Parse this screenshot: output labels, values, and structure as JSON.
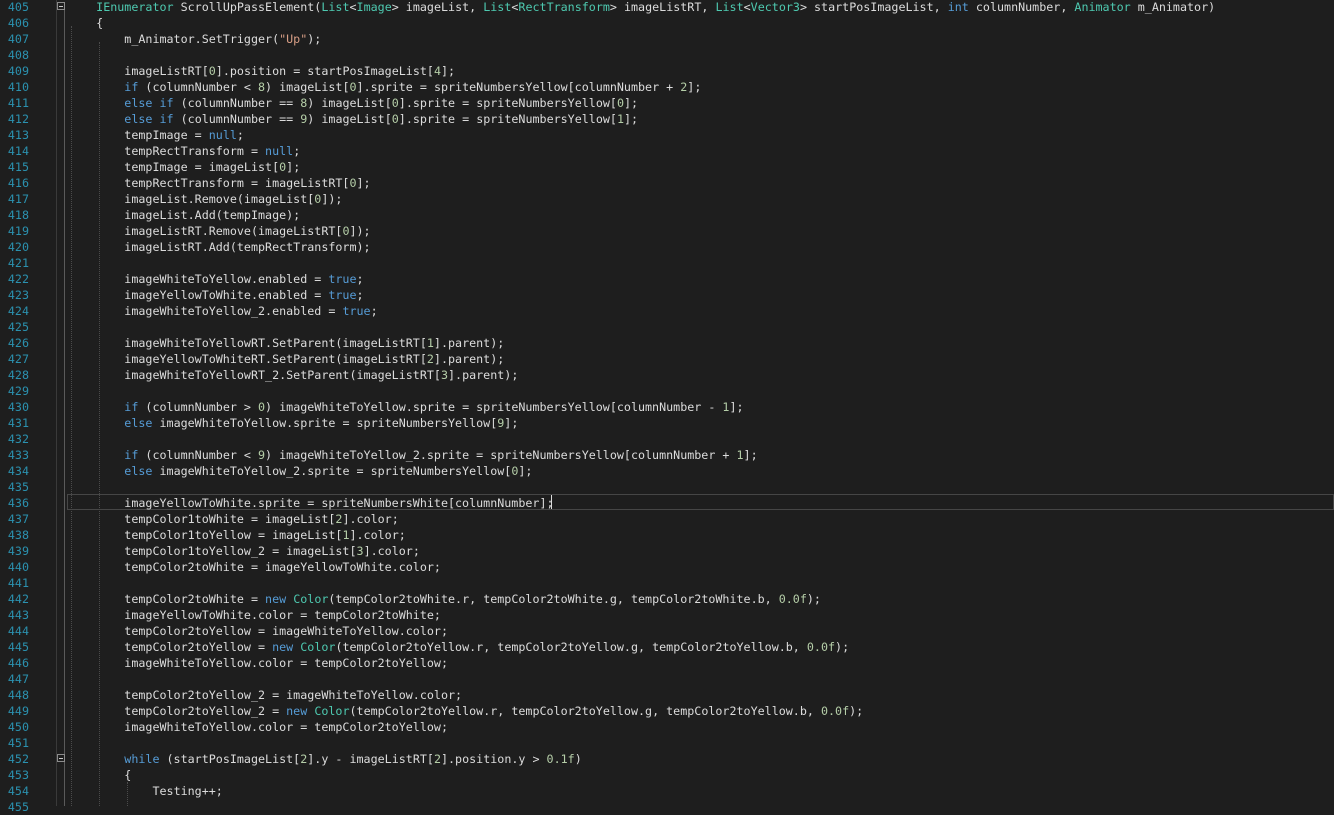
{
  "editor": {
    "language": "C#",
    "colors": {
      "background": "#1e1e1e",
      "line_number": "#2b91af",
      "keyword": "#569cd6",
      "type": "#4ec9b0",
      "string": "#d69d85",
      "number": "#b5cea8",
      "plain": "#dcdcdc"
    },
    "current_line": "436",
    "lines": [
      {
        "num": "405",
        "indent": "    ",
        "fold": true,
        "tokens": [
          {
            "t": "ty",
            "v": "IEnumerator"
          },
          {
            "t": "pl",
            "v": " ScrollUpPassElement("
          },
          {
            "t": "ty",
            "v": "List"
          },
          {
            "t": "pl",
            "v": "<"
          },
          {
            "t": "ty",
            "v": "Image"
          },
          {
            "t": "pl",
            "v": "> imageList, "
          },
          {
            "t": "ty",
            "v": "List"
          },
          {
            "t": "pl",
            "v": "<"
          },
          {
            "t": "ty",
            "v": "RectTransform"
          },
          {
            "t": "pl",
            "v": "> imageListRT, "
          },
          {
            "t": "ty",
            "v": "List"
          },
          {
            "t": "pl",
            "v": "<"
          },
          {
            "t": "ty",
            "v": "Vector3"
          },
          {
            "t": "pl",
            "v": "> startPosImageList, "
          },
          {
            "t": "kw",
            "v": "int"
          },
          {
            "t": "pl",
            "v": " columnNumber, "
          },
          {
            "t": "ty",
            "v": "Animator"
          },
          {
            "t": "pl",
            "v": " m_Animator)"
          }
        ]
      },
      {
        "num": "406",
        "indent": "    ",
        "tokens": [
          {
            "t": "pl",
            "v": "{"
          }
        ]
      },
      {
        "num": "407",
        "indent": "        ",
        "tokens": [
          {
            "t": "pl",
            "v": "m_Animator.SetTrigger("
          },
          {
            "t": "str",
            "v": "\"Up\""
          },
          {
            "t": "pl",
            "v": ");"
          }
        ]
      },
      {
        "num": "408",
        "indent": "",
        "tokens": []
      },
      {
        "num": "409",
        "indent": "        ",
        "tokens": [
          {
            "t": "pl",
            "v": "imageListRT["
          },
          {
            "t": "num",
            "v": "0"
          },
          {
            "t": "pl",
            "v": "].position = startPosImageList["
          },
          {
            "t": "num",
            "v": "4"
          },
          {
            "t": "pl",
            "v": "];"
          }
        ]
      },
      {
        "num": "410",
        "indent": "        ",
        "tokens": [
          {
            "t": "kw",
            "v": "if"
          },
          {
            "t": "pl",
            "v": " (columnNumber < "
          },
          {
            "t": "num",
            "v": "8"
          },
          {
            "t": "pl",
            "v": ") imageList["
          },
          {
            "t": "num",
            "v": "0"
          },
          {
            "t": "pl",
            "v": "].sprite = spriteNumbersYellow[columnNumber + "
          },
          {
            "t": "num",
            "v": "2"
          },
          {
            "t": "pl",
            "v": "];"
          }
        ]
      },
      {
        "num": "411",
        "indent": "        ",
        "tokens": [
          {
            "t": "kw",
            "v": "else"
          },
          {
            "t": "pl",
            "v": " "
          },
          {
            "t": "kw",
            "v": "if"
          },
          {
            "t": "pl",
            "v": " (columnNumber == "
          },
          {
            "t": "num",
            "v": "8"
          },
          {
            "t": "pl",
            "v": ") imageList["
          },
          {
            "t": "num",
            "v": "0"
          },
          {
            "t": "pl",
            "v": "].sprite = spriteNumbersYellow["
          },
          {
            "t": "num",
            "v": "0"
          },
          {
            "t": "pl",
            "v": "];"
          }
        ]
      },
      {
        "num": "412",
        "indent": "        ",
        "tokens": [
          {
            "t": "kw",
            "v": "else"
          },
          {
            "t": "pl",
            "v": " "
          },
          {
            "t": "kw",
            "v": "if"
          },
          {
            "t": "pl",
            "v": " (columnNumber == "
          },
          {
            "t": "num",
            "v": "9"
          },
          {
            "t": "pl",
            "v": ") imageList["
          },
          {
            "t": "num",
            "v": "0"
          },
          {
            "t": "pl",
            "v": "].sprite = spriteNumbersYellow["
          },
          {
            "t": "num",
            "v": "1"
          },
          {
            "t": "pl",
            "v": "];"
          }
        ]
      },
      {
        "num": "413",
        "indent": "        ",
        "tokens": [
          {
            "t": "pl",
            "v": "tempImage = "
          },
          {
            "t": "kw",
            "v": "null"
          },
          {
            "t": "pl",
            "v": ";"
          }
        ]
      },
      {
        "num": "414",
        "indent": "        ",
        "tokens": [
          {
            "t": "pl",
            "v": "tempRectTransform = "
          },
          {
            "t": "kw",
            "v": "null"
          },
          {
            "t": "pl",
            "v": ";"
          }
        ]
      },
      {
        "num": "415",
        "indent": "        ",
        "tokens": [
          {
            "t": "pl",
            "v": "tempImage = imageList["
          },
          {
            "t": "num",
            "v": "0"
          },
          {
            "t": "pl",
            "v": "];"
          }
        ]
      },
      {
        "num": "416",
        "indent": "        ",
        "tokens": [
          {
            "t": "pl",
            "v": "tempRectTransform = imageListRT["
          },
          {
            "t": "num",
            "v": "0"
          },
          {
            "t": "pl",
            "v": "];"
          }
        ]
      },
      {
        "num": "417",
        "indent": "        ",
        "tokens": [
          {
            "t": "pl",
            "v": "imageList.Remove(imageList["
          },
          {
            "t": "num",
            "v": "0"
          },
          {
            "t": "pl",
            "v": "]);"
          }
        ]
      },
      {
        "num": "418",
        "indent": "        ",
        "tokens": [
          {
            "t": "pl",
            "v": "imageList.Add(tempImage);"
          }
        ]
      },
      {
        "num": "419",
        "indent": "        ",
        "tokens": [
          {
            "t": "pl",
            "v": "imageListRT.Remove(imageListRT["
          },
          {
            "t": "num",
            "v": "0"
          },
          {
            "t": "pl",
            "v": "]);"
          }
        ]
      },
      {
        "num": "420",
        "indent": "        ",
        "tokens": [
          {
            "t": "pl",
            "v": "imageListRT.Add(tempRectTransform);"
          }
        ]
      },
      {
        "num": "421",
        "indent": "",
        "tokens": []
      },
      {
        "num": "422",
        "indent": "        ",
        "tokens": [
          {
            "t": "pl",
            "v": "imageWhiteToYellow.enabled = "
          },
          {
            "t": "kw",
            "v": "true"
          },
          {
            "t": "pl",
            "v": ";"
          }
        ]
      },
      {
        "num": "423",
        "indent": "        ",
        "tokens": [
          {
            "t": "pl",
            "v": "imageYellowToWhite.enabled = "
          },
          {
            "t": "kw",
            "v": "true"
          },
          {
            "t": "pl",
            "v": ";"
          }
        ]
      },
      {
        "num": "424",
        "indent": "        ",
        "tokens": [
          {
            "t": "pl",
            "v": "imageWhiteToYellow_2.enabled = "
          },
          {
            "t": "kw",
            "v": "true"
          },
          {
            "t": "pl",
            "v": ";"
          }
        ]
      },
      {
        "num": "425",
        "indent": "",
        "tokens": []
      },
      {
        "num": "426",
        "indent": "        ",
        "tokens": [
          {
            "t": "pl",
            "v": "imageWhiteToYellowRT.SetParent(imageListRT["
          },
          {
            "t": "num",
            "v": "1"
          },
          {
            "t": "pl",
            "v": "].parent);"
          }
        ]
      },
      {
        "num": "427",
        "indent": "        ",
        "tokens": [
          {
            "t": "pl",
            "v": "imageYellowToWhiteRT.SetParent(imageListRT["
          },
          {
            "t": "num",
            "v": "2"
          },
          {
            "t": "pl",
            "v": "].parent);"
          }
        ]
      },
      {
        "num": "428",
        "indent": "        ",
        "tokens": [
          {
            "t": "pl",
            "v": "imageWhiteToYellowRT_2.SetParent(imageListRT["
          },
          {
            "t": "num",
            "v": "3"
          },
          {
            "t": "pl",
            "v": "].parent);"
          }
        ]
      },
      {
        "num": "429",
        "indent": "",
        "tokens": []
      },
      {
        "num": "430",
        "indent": "        ",
        "tokens": [
          {
            "t": "kw",
            "v": "if"
          },
          {
            "t": "pl",
            "v": " (columnNumber > "
          },
          {
            "t": "num",
            "v": "0"
          },
          {
            "t": "pl",
            "v": ") imageWhiteToYellow.sprite = spriteNumbersYellow[columnNumber - "
          },
          {
            "t": "num",
            "v": "1"
          },
          {
            "t": "pl",
            "v": "];"
          }
        ]
      },
      {
        "num": "431",
        "indent": "        ",
        "tokens": [
          {
            "t": "kw",
            "v": "else"
          },
          {
            "t": "pl",
            "v": " imageWhiteToYellow.sprite = spriteNumbersYellow["
          },
          {
            "t": "num",
            "v": "9"
          },
          {
            "t": "pl",
            "v": "];"
          }
        ]
      },
      {
        "num": "432",
        "indent": "",
        "tokens": []
      },
      {
        "num": "433",
        "indent": "        ",
        "tokens": [
          {
            "t": "kw",
            "v": "if"
          },
          {
            "t": "pl",
            "v": " (columnNumber < "
          },
          {
            "t": "num",
            "v": "9"
          },
          {
            "t": "pl",
            "v": ") imageWhiteToYellow_2.sprite = spriteNumbersYellow[columnNumber + "
          },
          {
            "t": "num",
            "v": "1"
          },
          {
            "t": "pl",
            "v": "];"
          }
        ]
      },
      {
        "num": "434",
        "indent": "        ",
        "tokens": [
          {
            "t": "kw",
            "v": "else"
          },
          {
            "t": "pl",
            "v": " imageWhiteToYellow_2.sprite = spriteNumbersYellow["
          },
          {
            "t": "num",
            "v": "0"
          },
          {
            "t": "pl",
            "v": "];"
          }
        ]
      },
      {
        "num": "435",
        "indent": "",
        "tokens": []
      },
      {
        "num": "436",
        "indent": "        ",
        "tokens": [
          {
            "t": "pl",
            "v": "imageYellowToWhite.sprite = spriteNumbersWhite[columnNumber];"
          }
        ]
      },
      {
        "num": "437",
        "indent": "        ",
        "tokens": [
          {
            "t": "pl",
            "v": "tempColor1toWhite = imageList["
          },
          {
            "t": "num",
            "v": "2"
          },
          {
            "t": "pl",
            "v": "].color;"
          }
        ]
      },
      {
        "num": "438",
        "indent": "        ",
        "tokens": [
          {
            "t": "pl",
            "v": "tempColor1toYellow = imageList["
          },
          {
            "t": "num",
            "v": "1"
          },
          {
            "t": "pl",
            "v": "].color;"
          }
        ]
      },
      {
        "num": "439",
        "indent": "        ",
        "tokens": [
          {
            "t": "pl",
            "v": "tempColor1toYellow_2 = imageList["
          },
          {
            "t": "num",
            "v": "3"
          },
          {
            "t": "pl",
            "v": "].color;"
          }
        ]
      },
      {
        "num": "440",
        "indent": "        ",
        "tokens": [
          {
            "t": "pl",
            "v": "tempColor2toWhite = imageYellowToWhite.color;"
          }
        ]
      },
      {
        "num": "441",
        "indent": "",
        "tokens": []
      },
      {
        "num": "442",
        "indent": "        ",
        "tokens": [
          {
            "t": "pl",
            "v": "tempColor2toWhite = "
          },
          {
            "t": "kw",
            "v": "new"
          },
          {
            "t": "pl",
            "v": " "
          },
          {
            "t": "ty",
            "v": "Color"
          },
          {
            "t": "pl",
            "v": "(tempColor2toWhite.r, tempColor2toWhite.g, tempColor2toWhite.b, "
          },
          {
            "t": "num",
            "v": "0.0f"
          },
          {
            "t": "pl",
            "v": ");"
          }
        ]
      },
      {
        "num": "443",
        "indent": "        ",
        "tokens": [
          {
            "t": "pl",
            "v": "imageYellowToWhite.color = tempColor2toWhite;"
          }
        ]
      },
      {
        "num": "444",
        "indent": "        ",
        "tokens": [
          {
            "t": "pl",
            "v": "tempColor2toYellow = imageWhiteToYellow.color;"
          }
        ]
      },
      {
        "num": "445",
        "indent": "        ",
        "tokens": [
          {
            "t": "pl",
            "v": "tempColor2toYellow = "
          },
          {
            "t": "kw",
            "v": "new"
          },
          {
            "t": "pl",
            "v": " "
          },
          {
            "t": "ty",
            "v": "Color"
          },
          {
            "t": "pl",
            "v": "(tempColor2toYellow.r, tempColor2toYellow.g, tempColor2toYellow.b, "
          },
          {
            "t": "num",
            "v": "0.0f"
          },
          {
            "t": "pl",
            "v": ");"
          }
        ]
      },
      {
        "num": "446",
        "indent": "        ",
        "tokens": [
          {
            "t": "pl",
            "v": "imageWhiteToYellow.color = tempColor2toYellow;"
          }
        ]
      },
      {
        "num": "447",
        "indent": "",
        "tokens": []
      },
      {
        "num": "448",
        "indent": "        ",
        "tokens": [
          {
            "t": "pl",
            "v": "tempColor2toYellow_2 = imageWhiteToYellow.color;"
          }
        ]
      },
      {
        "num": "449",
        "indent": "        ",
        "tokens": [
          {
            "t": "pl",
            "v": "tempColor2toYellow_2 = "
          },
          {
            "t": "kw",
            "v": "new"
          },
          {
            "t": "pl",
            "v": " "
          },
          {
            "t": "ty",
            "v": "Color"
          },
          {
            "t": "pl",
            "v": "(tempColor2toYellow.r, tempColor2toYellow.g, tempColor2toYellow.b, "
          },
          {
            "t": "num",
            "v": "0.0f"
          },
          {
            "t": "pl",
            "v": ");"
          }
        ]
      },
      {
        "num": "450",
        "indent": "        ",
        "tokens": [
          {
            "t": "pl",
            "v": "imageWhiteToYellow.color = tempColor2toYellow;"
          }
        ]
      },
      {
        "num": "451",
        "indent": "",
        "tokens": []
      },
      {
        "num": "452",
        "indent": "        ",
        "fold": true,
        "tokens": [
          {
            "t": "kw",
            "v": "while"
          },
          {
            "t": "pl",
            "v": " (startPosImageList["
          },
          {
            "t": "num",
            "v": "2"
          },
          {
            "t": "pl",
            "v": "].y - imageListRT["
          },
          {
            "t": "num",
            "v": "2"
          },
          {
            "t": "pl",
            "v": "].position.y > "
          },
          {
            "t": "num",
            "v": "0.1f"
          },
          {
            "t": "pl",
            "v": ")"
          }
        ]
      },
      {
        "num": "453",
        "indent": "        ",
        "tokens": [
          {
            "t": "pl",
            "v": "{"
          }
        ]
      },
      {
        "num": "454",
        "indent": "            ",
        "tokens": [
          {
            "t": "pl",
            "v": "Testing++;"
          }
        ]
      },
      {
        "num": "455",
        "indent": "",
        "tokens": []
      }
    ]
  }
}
